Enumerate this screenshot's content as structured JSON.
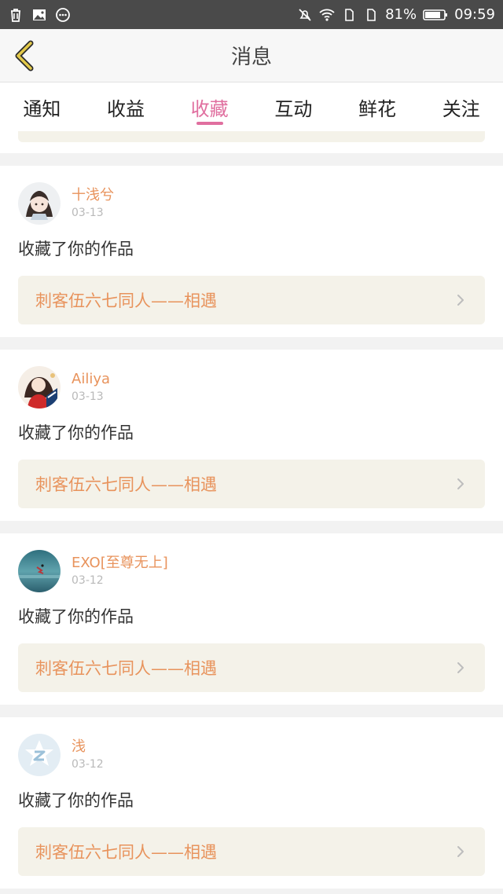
{
  "status_bar": {
    "battery": "81%",
    "time": "09:59",
    "left_icons": [
      "trash-icon",
      "image-icon",
      "more-circle-icon"
    ],
    "right_icons": [
      "mute-icon",
      "wifi-icon",
      "sim1-icon",
      "sim2-icon",
      "battery-icon"
    ]
  },
  "header": {
    "title": "消息",
    "back_icon": "chevron-left-icon"
  },
  "tabs": [
    {
      "label": "通知",
      "active": false
    },
    {
      "label": "收益",
      "active": false
    },
    {
      "label": "收藏",
      "active": true
    },
    {
      "label": "互动",
      "active": false
    },
    {
      "label": "鲜花",
      "active": false
    },
    {
      "label": "关注",
      "active": false
    }
  ],
  "colors": {
    "accent_pink": "#e06f9f",
    "username_orange": "#e8935c",
    "link_bg": "#f4f2e9",
    "date_gray": "#b9b9b9"
  },
  "messages": [
    {
      "username": "十浅兮",
      "date": "03-13",
      "action": "收藏了你的作品",
      "work_title": "刺客伍六七同人——相遇"
    },
    {
      "username": "Ailiya",
      "date": "03-13",
      "action": "收藏了你的作品",
      "work_title": "刺客伍六七同人——相遇"
    },
    {
      "username": "EXO[至尊无上]",
      "date": "03-12",
      "action": "收藏了你的作品",
      "work_title": "刺客伍六七同人——相遇"
    },
    {
      "username": "浅",
      "date": "03-12",
      "action": "收藏了你的作品",
      "work_title": "刺客伍六七同人——相遇"
    }
  ]
}
